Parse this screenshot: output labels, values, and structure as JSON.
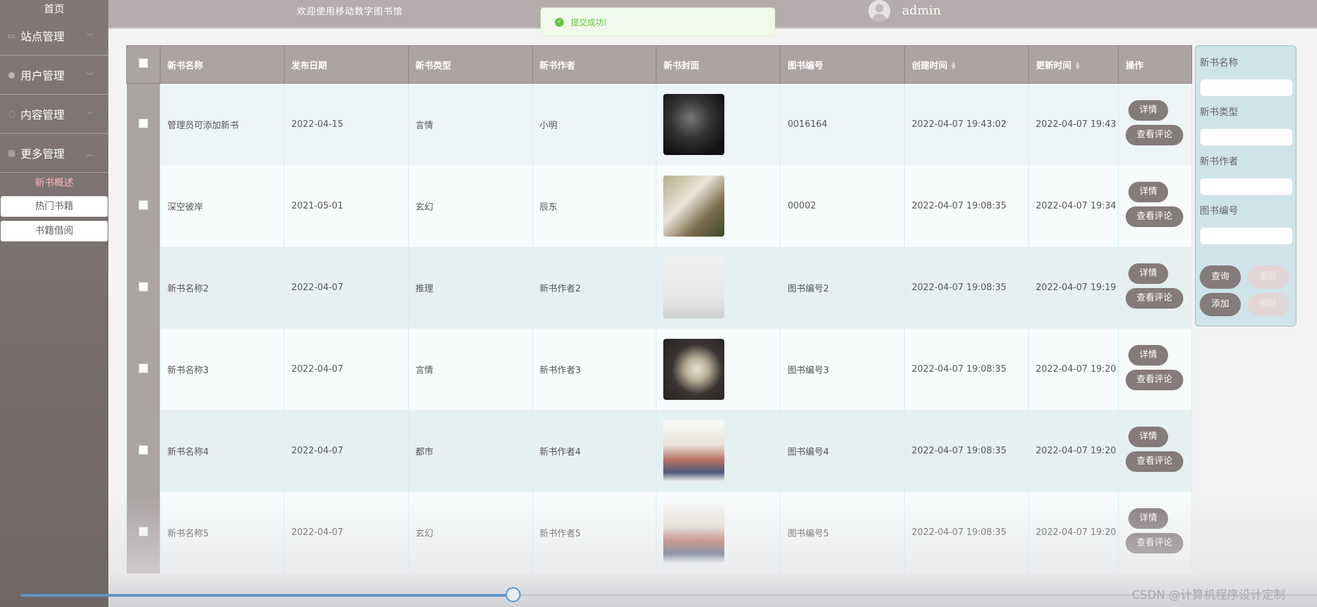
{
  "sidebar": {
    "home": "首页",
    "menus": [
      {
        "label": "站点管理",
        "icon": "monitor-icon"
      },
      {
        "label": "用户管理",
        "icon": "user-icon"
      },
      {
        "label": "内容管理",
        "icon": "chat-icon"
      },
      {
        "label": "更多管理",
        "icon": "grid-icon"
      }
    ],
    "sub_items": [
      "新书概述",
      "热门书籍",
      "书籍借阅"
    ]
  },
  "header": {
    "welcome": "欢迎使用移动数字图书馆",
    "username": "admin"
  },
  "toast": {
    "message": "提交成功!"
  },
  "table": {
    "headers": [
      "新书名称",
      "发布日期",
      "新书类型",
      "新书作者",
      "新书封面",
      "图书编号",
      "创建时间",
      "更新时间",
      "操作"
    ],
    "rows": [
      {
        "name": "管理员可添加新书",
        "date": "2022-04-15",
        "type": "言情",
        "author": "小明",
        "number": "0016164",
        "created": "2022-04-07 19:43:02",
        "updated": "2022-04-07 19:43"
      },
      {
        "name": "深空彼岸",
        "date": "2021-05-01",
        "type": "玄幻",
        "author": "辰东",
        "number": "00002",
        "created": "2022-04-07 19:08:35",
        "updated": "2022-04-07 19:34"
      },
      {
        "name": "新书名称2",
        "date": "2022-04-07",
        "type": "推理",
        "author": "新书作者2",
        "number": "图书编号2",
        "created": "2022-04-07 19:08:35",
        "updated": "2022-04-07 19:19"
      },
      {
        "name": "新书名称3",
        "date": "2022-04-07",
        "type": "言情",
        "author": "新书作者3",
        "number": "图书编号3",
        "created": "2022-04-07 19:08:35",
        "updated": "2022-04-07 19:20"
      },
      {
        "name": "新书名称4",
        "date": "2022-04-07",
        "type": "都市",
        "author": "新书作者4",
        "number": "图书编号4",
        "created": "2022-04-07 19:08:35",
        "updated": "2022-04-07 19:20"
      },
      {
        "name": "新书名称5",
        "date": "2022-04-07",
        "type": "玄幻",
        "author": "新书作者5",
        "number": "图书编号5",
        "created": "2022-04-07 19:08:35",
        "updated": "2022-04-07 19:20"
      }
    ],
    "detail_label": "详情",
    "comment_label": "查看评论"
  },
  "search": {
    "fields": [
      "新书名称",
      "新书类型",
      "新书作者",
      "图书编号"
    ],
    "query": "查询",
    "reset": "重置",
    "add": "添加",
    "delete": "删除"
  },
  "video": {
    "progress": 0.38
  },
  "watermark": "CSDN @计算机程序设计定制",
  "colors": {
    "sidebar": "#766e6d",
    "header": "#b5adad",
    "accent_button": "#857b7b",
    "panel": "#cfe3ea",
    "toast_text": "#67c23a"
  }
}
